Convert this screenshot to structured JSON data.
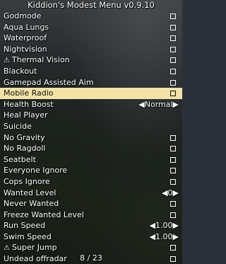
{
  "menu": {
    "title": "Kiddion's Modest Menu v0.9.10",
    "page_indicator": "8 / 23",
    "highlight_color": "#f3e3a7",
    "items": [
      {
        "label": "Godmode",
        "control": "checkbox",
        "warning": false
      },
      {
        "label": "Aqua Lungs",
        "control": "checkbox",
        "warning": false
      },
      {
        "label": "Waterproof",
        "control": "checkbox",
        "warning": false
      },
      {
        "label": "Nightvision",
        "control": "checkbox",
        "warning": false
      },
      {
        "label": "Thermal Vision",
        "control": "checkbox",
        "warning": true
      },
      {
        "label": "Blackout",
        "control": "checkbox",
        "warning": false
      },
      {
        "label": "Gamepad Assisted Aim",
        "control": "checkbox",
        "warning": false
      },
      {
        "label": "Mobile Radio",
        "control": "checkbox",
        "warning": false,
        "selected": true
      },
      {
        "label": "Health Boost",
        "control": "selector",
        "value": "◀Normal▶",
        "warning": false
      },
      {
        "label": "Heal Player",
        "control": "action",
        "warning": false
      },
      {
        "label": "Suicide",
        "control": "action",
        "warning": false
      },
      {
        "label": "No Gravity",
        "control": "checkbox",
        "warning": false
      },
      {
        "label": "No Ragdoll",
        "control": "checkbox",
        "warning": false
      },
      {
        "label": "Seatbelt",
        "control": "checkbox",
        "warning": false
      },
      {
        "label": "Everyone Ignore",
        "control": "checkbox",
        "warning": false
      },
      {
        "label": "Cops Ignore",
        "control": "checkbox",
        "warning": false
      },
      {
        "label": "Wanted Level",
        "control": "selector",
        "value": "◀0▶",
        "warning": false
      },
      {
        "label": "Never Wanted",
        "control": "checkbox",
        "warning": false
      },
      {
        "label": "Freeze Wanted Level",
        "control": "checkbox",
        "warning": false
      },
      {
        "label": "Run Speed",
        "control": "selector",
        "value": "◀1.00▶",
        "warning": false
      },
      {
        "label": "Swim Speed",
        "control": "selector",
        "value": "◀1.00▶",
        "warning": false
      },
      {
        "label": "Super Jump",
        "control": "checkbox",
        "warning": true
      },
      {
        "label": "Undead offradar",
        "control": "checkbox",
        "warning": false
      }
    ]
  }
}
